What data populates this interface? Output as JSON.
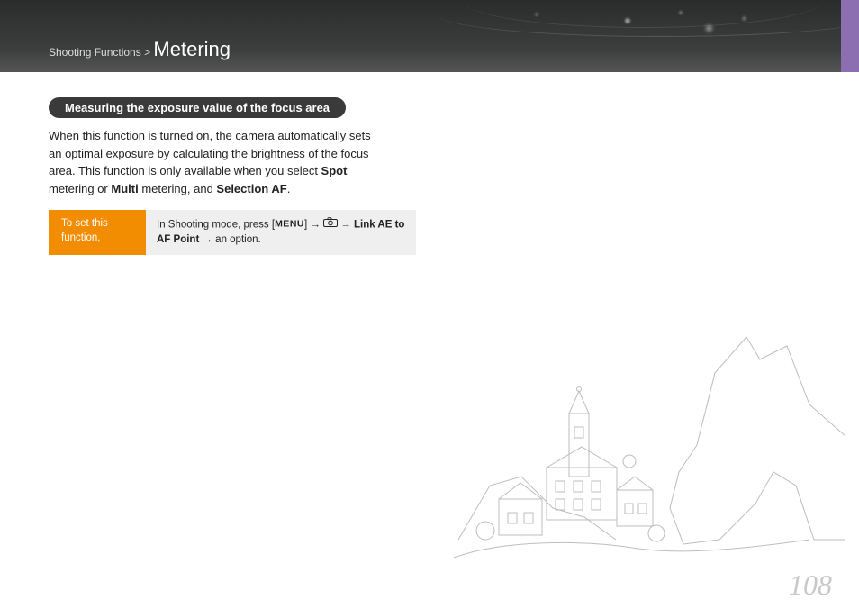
{
  "header": {
    "breadcrumb_section": "Shooting Functions",
    "breadcrumb_sep": " > ",
    "title": "Metering"
  },
  "section": {
    "heading": "Measuring the exposure value of the focus area",
    "paragraph": {
      "pre": "When this function is turned on, the camera automatically sets an optimal exposure by calculating the brightness of the focus area. This function is only available when you select ",
      "b1": "Spot",
      "mid1": " metering or ",
      "b2": "Multi",
      "mid2": " metering, and ",
      "b3": "Selection AF",
      "tail": "."
    }
  },
  "instruction": {
    "label_l1": "To set this",
    "label_l2": "function,",
    "body_pre": "In Shooting mode, press [",
    "menu_label": "MENU",
    "body_mid1": "] ",
    "arrow": "→",
    "body_mid2": " ",
    "body_mid3": " ",
    "link_bold": "Link AE to AF Point",
    "body_tail": " → an option."
  },
  "page": {
    "number": "108"
  }
}
